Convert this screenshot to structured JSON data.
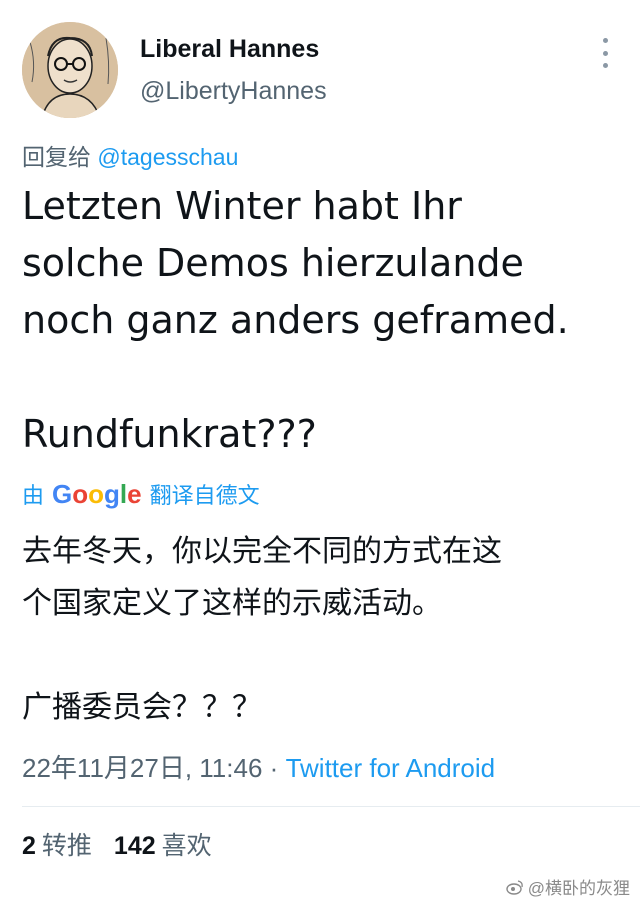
{
  "author": {
    "display_name": "Liberal Hannes",
    "handle": "@LibertyHannes"
  },
  "reply": {
    "prefix": "回复给",
    "mention": "@tagesschau"
  },
  "tweet": {
    "text": "Letzten Winter habt Ihr\nsolche Demos hierzulande\nnoch ganz anders geframed.\n\nRundfunkrat???"
  },
  "translation": {
    "prefix": "由",
    "provider": "Google",
    "suffix": "翻译自德文",
    "text": "去年冬天，你以完全不同的方式在这\n个国家定义了这样的示威活动。\n\n广播委员会？？？"
  },
  "meta": {
    "timestamp": "22年11月27日, 11:46",
    "separator": "·",
    "source": "Twitter for Android"
  },
  "stats": {
    "retweets_count": "2",
    "retweets_label": "转推",
    "likes_count": "142",
    "likes_label": "喜欢"
  },
  "watermark": {
    "text": "@横卧的灰狸"
  },
  "colors": {
    "link": "#1d9bf0",
    "secondary_text": "#536471",
    "primary_text": "#0f1419"
  }
}
